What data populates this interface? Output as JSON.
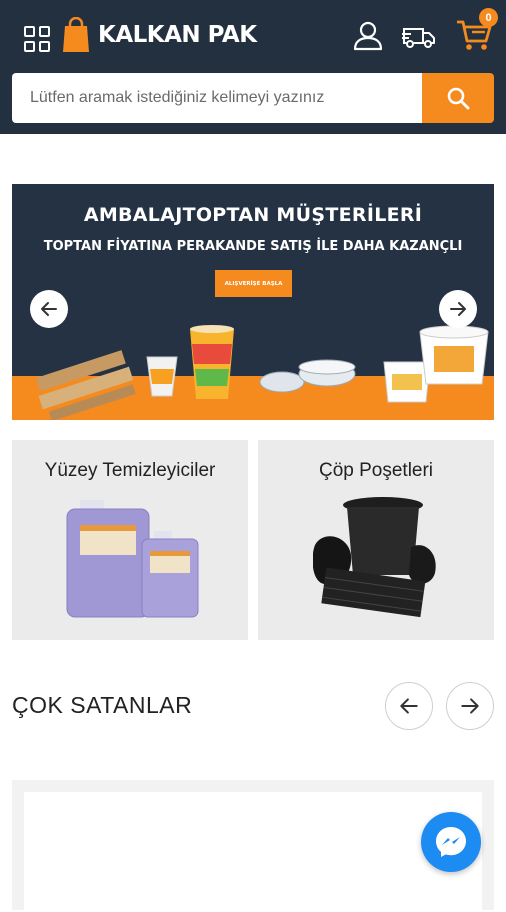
{
  "header": {
    "brand_name": "KALKAN PAK",
    "cart_count": "0",
    "colors": {
      "background": "#233040",
      "accent": "#f58a1f"
    },
    "icons": [
      "menu-grid-icon",
      "shopping-bag-icon",
      "user-icon",
      "delivery-truck-icon",
      "shopping-cart-icon"
    ]
  },
  "search": {
    "placeholder": "Lütfen aramak istediğiniz kelimeyi yazınız",
    "icon": "search-icon"
  },
  "banner": {
    "title": "AMBALAJTOPTAN MÜŞTERİLERİ",
    "subtitle": "TOPTAN FİYATINA PERAKANDE SATIŞ İLE DAHA KAZANÇLI",
    "cta_label": "ALIŞVERİŞE BAŞLA",
    "icons": [
      "arrow-left-icon",
      "arrow-right-icon"
    ]
  },
  "categories": [
    {
      "label": "Yüzey Temizleyiciler"
    },
    {
      "label": "Çöp Poşetleri"
    }
  ],
  "best_sellers": {
    "title": "ÇOK SATANLAR",
    "icons": [
      "arrow-left-icon",
      "arrow-right-icon"
    ]
  },
  "messenger": {
    "icon": "messenger-icon"
  }
}
